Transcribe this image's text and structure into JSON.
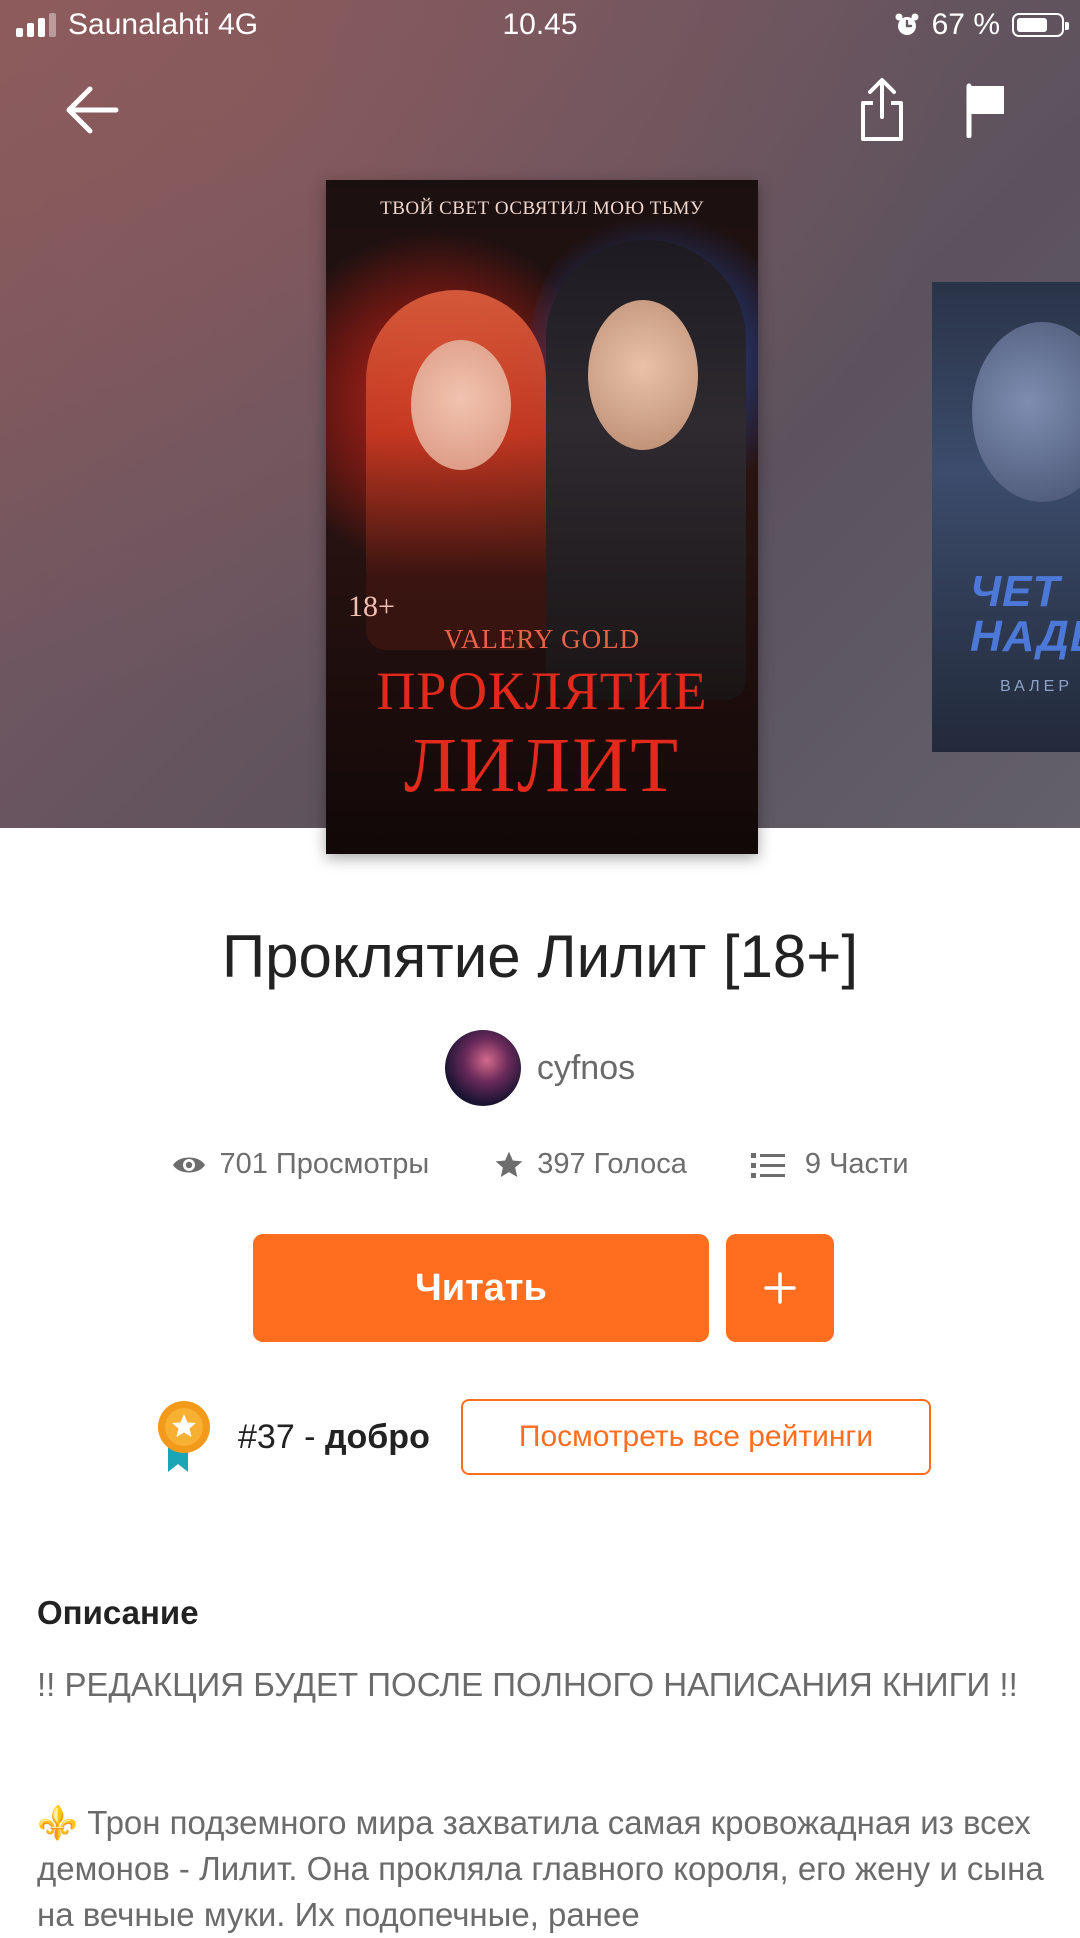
{
  "status_bar": {
    "carrier": "Saunalahti 4G",
    "time": "10.45",
    "battery": "67 %",
    "battery_level": 0.67
  },
  "nav": {
    "back_icon": "arrow-left-icon",
    "share_icon": "share-icon",
    "report_icon": "flag-icon"
  },
  "cover": {
    "tagline": "ТВОЙ СВЕТ ОСВЯТИЛ МОЮ ТЬМУ",
    "age": "18+",
    "author": "VALERY GOLD",
    "title_line1": "ПРОКЛЯТИЕ",
    "title_line2": "ЛИЛИТ"
  },
  "next_cover": {
    "title_line1": "ЧЕТ",
    "title_line2": "НАДЕ",
    "author": "ВАЛЕР"
  },
  "story": {
    "title": "Проклятие Лилит [18+]",
    "author": "cyfnos",
    "views": "701 Просмотры",
    "votes": "397 Голоса",
    "parts": "9 Части"
  },
  "actions": {
    "read_label": "Читать",
    "add_label": "+",
    "ratings_label": "Посмотреть все рейтинги"
  },
  "ranking": {
    "rank": "#37",
    "separator": " - ",
    "tag": "добро"
  },
  "description": {
    "heading": "Описание",
    "paragraph1": "!! РЕДАКЦИЯ БУДЕТ ПОСЛЕ ПОЛНОГО НАПИСАНИЯ КНИГИ !!",
    "emoji": "⚜️",
    "paragraph2": "Трон подземного мира захватила самая кровожадная из всех демонов - Лилит. Она прокляла главного короля, его жену и сына на вечные муки. Их подопечные, ранее"
  },
  "colors": {
    "accent": "#ff6d1f",
    "text_dark": "#222222",
    "text_muted": "#6b6b6b"
  }
}
